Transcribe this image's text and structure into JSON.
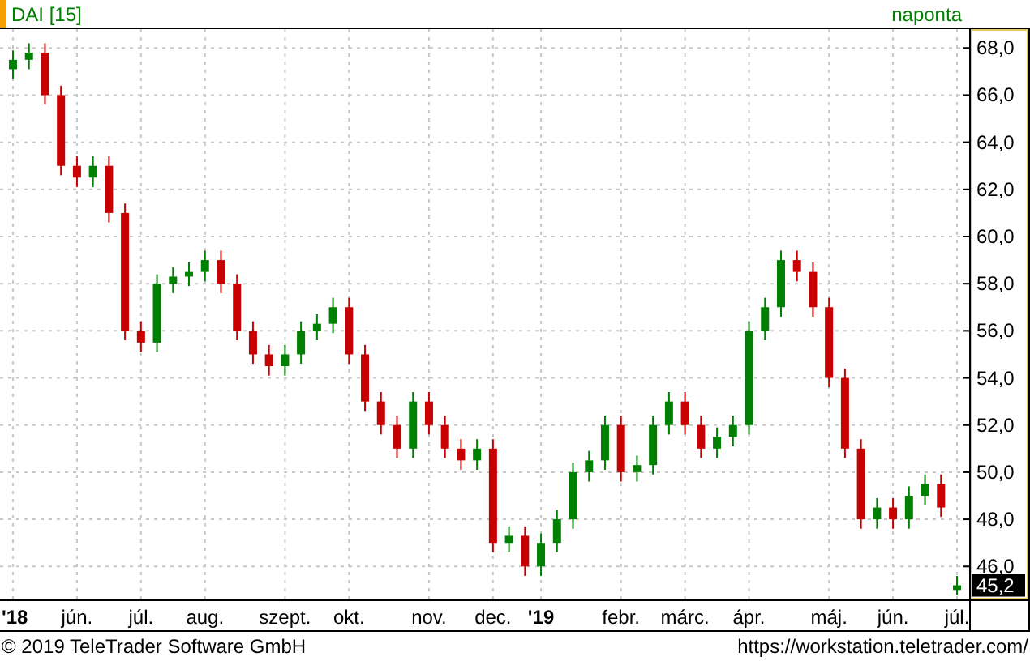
{
  "header": {
    "symbol": "DAI [15]",
    "interval": "naponta"
  },
  "chart": {
    "last_price": "45,2",
    "chart_data": {
      "type": "candlestick",
      "categories": [
        "**'18**",
        null,
        null,
        null,
        "jún.",
        null,
        null,
        null,
        "júl.",
        null,
        null,
        null,
        "aug.",
        null,
        null,
        null,
        null,
        "szept.",
        null,
        null,
        null,
        "okt.",
        null,
        null,
        null,
        null,
        "nov.",
        null,
        null,
        null,
        "dec.",
        null,
        null,
        "**'19**",
        null,
        null,
        null,
        null,
        "febr.",
        null,
        null,
        null,
        "márc.",
        null,
        null,
        null,
        "ápr.",
        null,
        null,
        null,
        null,
        "máj.",
        null,
        null,
        null,
        "jún.",
        null,
        null,
        null,
        "júl."
      ],
      "ohlc": [
        [
          67.1,
          67.9,
          66.7,
          67.5
        ],
        [
          67.5,
          68.2,
          67.1,
          67.8
        ],
        [
          67.8,
          68.2,
          65.6,
          66
        ],
        [
          66,
          66.4,
          62.6,
          63
        ],
        [
          63,
          63.4,
          62.1,
          62.5
        ],
        [
          62.5,
          63.4,
          62.1,
          63
        ],
        [
          63,
          63.4,
          60.6,
          61
        ],
        [
          61,
          61.4,
          55.6,
          56
        ],
        [
          56,
          56.4,
          55.1,
          55.5
        ],
        [
          55.5,
          58.4,
          55.1,
          58
        ],
        [
          58,
          58.7,
          57.6,
          58.3
        ],
        [
          58.3,
          58.9,
          57.9,
          58.5
        ],
        [
          58.5,
          59.4,
          58.1,
          59
        ],
        [
          59,
          59.4,
          57.6,
          58
        ],
        [
          58,
          58.4,
          55.6,
          56
        ],
        [
          56,
          56.4,
          54.6,
          55
        ],
        [
          55,
          55.4,
          54.1,
          54.5
        ],
        [
          54.5,
          55.4,
          54.1,
          55
        ],
        [
          55,
          56.4,
          54.6,
          56
        ],
        [
          56,
          56.7,
          55.6,
          56.3
        ],
        [
          56.3,
          57.4,
          55.9,
          57
        ],
        [
          57,
          57.4,
          54.6,
          55
        ],
        [
          55,
          55.4,
          52.6,
          53
        ],
        [
          53,
          53.4,
          51.6,
          52
        ],
        [
          52,
          52.4,
          50.6,
          51
        ],
        [
          51,
          53.4,
          50.6,
          53
        ],
        [
          53,
          53.4,
          51.6,
          52
        ],
        [
          52,
          52.4,
          50.6,
          51
        ],
        [
          51,
          51.4,
          50.1,
          50.5
        ],
        [
          50.5,
          51.4,
          50.1,
          51
        ],
        [
          51,
          51.4,
          46.6,
          47
        ],
        [
          47,
          47.7,
          46.6,
          47.3
        ],
        [
          47.3,
          47.7,
          45.6,
          46
        ],
        [
          46,
          47.4,
          45.6,
          47
        ],
        [
          47,
          48.4,
          46.6,
          48
        ],
        [
          48,
          50.4,
          47.6,
          50
        ],
        [
          50,
          50.9,
          49.6,
          50.5
        ],
        [
          50.5,
          52.4,
          50.1,
          52
        ],
        [
          52,
          52.4,
          49.6,
          50
        ],
        [
          50,
          50.7,
          49.6,
          50.3
        ],
        [
          50.3,
          52.4,
          49.9,
          52
        ],
        [
          52,
          53.4,
          51.6,
          53
        ],
        [
          53,
          53.4,
          51.6,
          52
        ],
        [
          52,
          52.4,
          50.6,
          51
        ],
        [
          51,
          51.9,
          50.6,
          51.5
        ],
        [
          51.5,
          52.4,
          51.1,
          52
        ],
        [
          52,
          56.4,
          51.6,
          56
        ],
        [
          56,
          57.4,
          55.6,
          57
        ],
        [
          57,
          59.4,
          56.6,
          59
        ],
        [
          59,
          59.4,
          58.1,
          58.5
        ],
        [
          58.5,
          58.9,
          56.6,
          57
        ],
        [
          57,
          57.4,
          53.6,
          54
        ],
        [
          54,
          54.4,
          50.6,
          51
        ],
        [
          51,
          51.4,
          47.6,
          48
        ],
        [
          48,
          48.9,
          47.6,
          48.5
        ],
        [
          48.5,
          48.9,
          47.6,
          48
        ],
        [
          48,
          49.4,
          47.6,
          49
        ],
        [
          49,
          49.9,
          48.6,
          49.5
        ],
        [
          49.5,
          49.9,
          48.1,
          48.5
        ],
        [
          45,
          45.6,
          44.8,
          45.2
        ]
      ],
      "ylim": [
        44.6,
        68.8
      ],
      "grid": true,
      "yticks": [
        {
          "value": 46,
          "label": "46,0"
        },
        {
          "value": 48,
          "label": "48,0"
        },
        {
          "value": 50,
          "label": "50,0"
        },
        {
          "value": 52,
          "label": "52,0"
        },
        {
          "value": 54,
          "label": "54,0"
        },
        {
          "value": 56,
          "label": "56,0"
        },
        {
          "value": 58,
          "label": "58,0"
        },
        {
          "value": 60,
          "label": "60,0"
        },
        {
          "value": 62,
          "label": "62,0"
        },
        {
          "value": 64,
          "label": "64,0"
        },
        {
          "value": 66,
          "label": "66,0"
        },
        {
          "value": 68,
          "label": "68,0"
        }
      ]
    }
  },
  "footer": {
    "copyright": "© 2019 TeleTrader Software GmbH",
    "url": "https://workstation.teletrader.com/"
  }
}
